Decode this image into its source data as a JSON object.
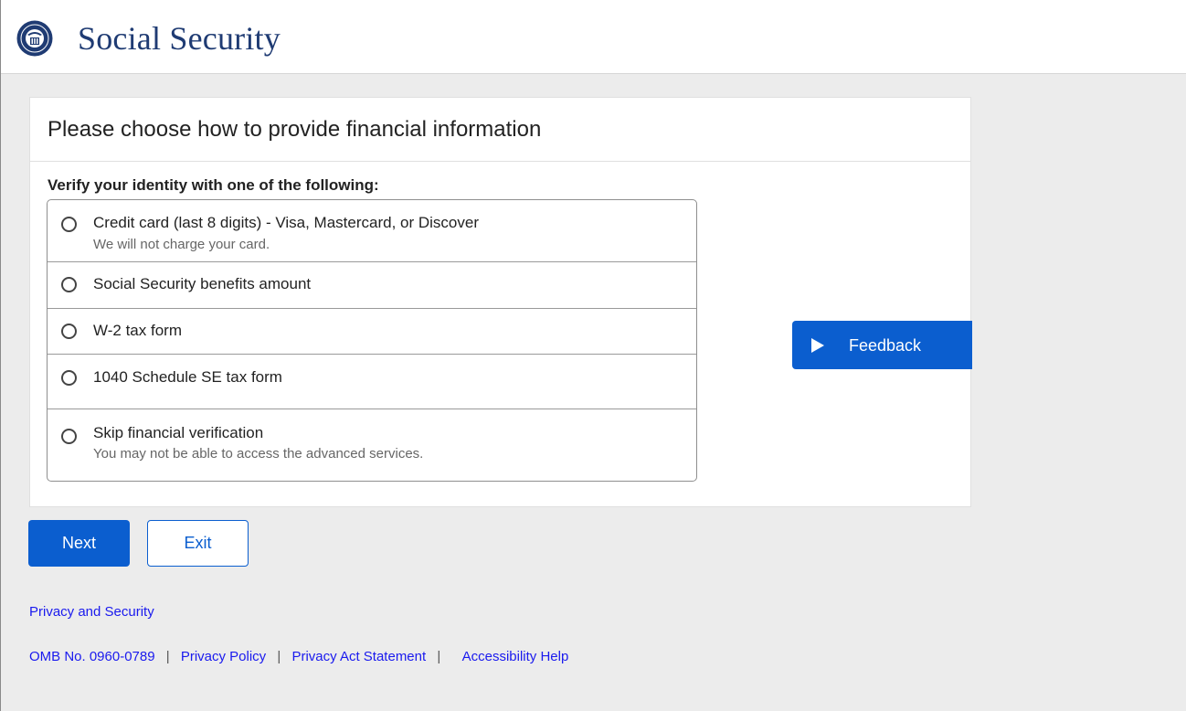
{
  "header": {
    "brand": "Social Security",
    "seal_icon": "ssa-seal-icon"
  },
  "card": {
    "title": "Please choose how to provide financial information",
    "subheading": "Verify your identity with one of the following:",
    "options": [
      {
        "label": "Credit card (last 8 digits) - Visa, Mastercard, or Discover",
        "hint": "We will not charge your card."
      },
      {
        "label": "Social Security benefits amount"
      },
      {
        "label": "W-2 tax form"
      },
      {
        "label": "1040 Schedule SE tax form"
      },
      {
        "label": "Skip financial verification",
        "hint": "You may not be able to access the advanced services."
      }
    ],
    "feedback_label": "Feedback"
  },
  "actions": {
    "next_label": "Next",
    "exit_label": "Exit"
  },
  "links": {
    "privacy_security": "Privacy and Security"
  },
  "footer": {
    "omb": "OMB No. 0960-0789",
    "separator": "|",
    "privacy_policy": "Privacy Policy",
    "privacy_act": "Privacy Act Statement",
    "accessibility": "Accessibility Help"
  },
  "colors": {
    "primary": "#0b5ecf",
    "brand_text": "#1f3b73",
    "page_bg": "#ececec",
    "link": "#1a1aee"
  }
}
